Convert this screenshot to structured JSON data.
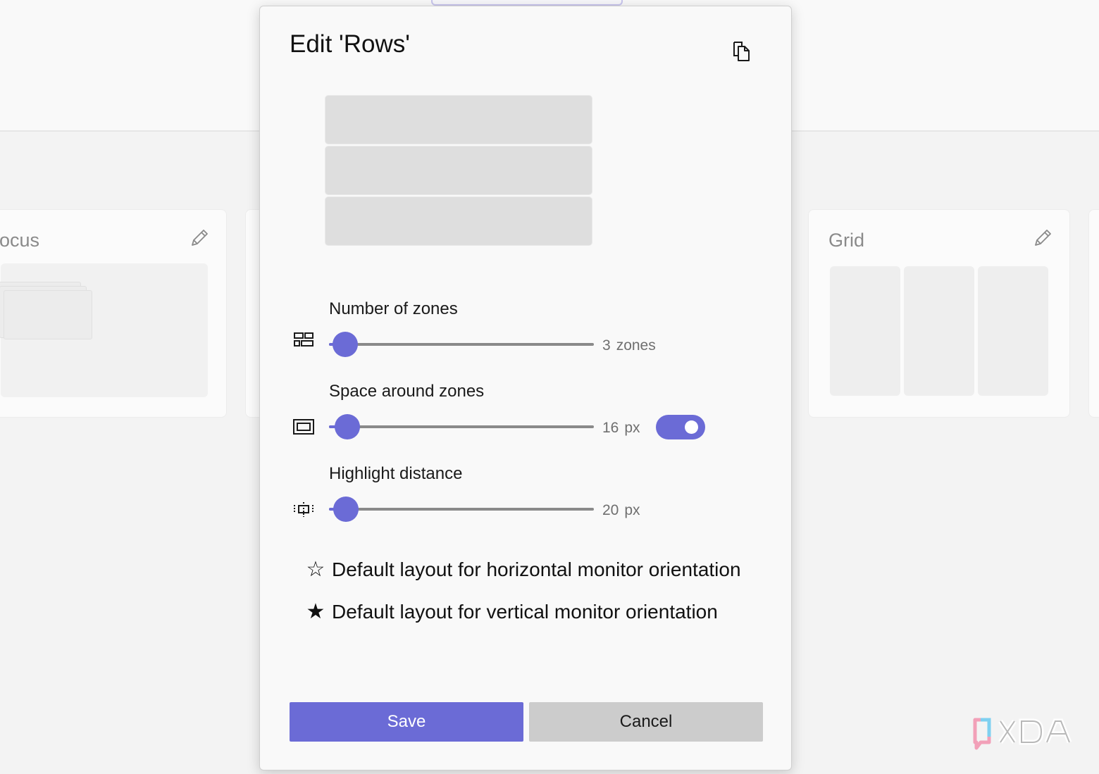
{
  "background": {
    "cards": [
      {
        "title": "ocus",
        "edit_icon": "pencil-icon"
      },
      {
        "title": "Grid",
        "edit_icon": "pencil-icon"
      }
    ]
  },
  "dialog": {
    "title": "Edit 'Rows'",
    "copy_icon": "copy-icon",
    "preview_zone_count": 3,
    "settings": [
      {
        "label": "Number of zones",
        "icon": "zones-grid-icon",
        "value": "3",
        "unit": "zones",
        "slider_fraction": 0.06
      },
      {
        "label": "Space around zones",
        "icon": "space-frame-icon",
        "value": "16",
        "unit": "px",
        "slider_fraction": 0.07,
        "toggle_on": true
      },
      {
        "label": "Highlight distance",
        "icon": "highlight-distance-icon",
        "value": "20",
        "unit": "px",
        "slider_fraction": 0.065
      }
    ],
    "defaults": [
      {
        "label": "Default layout for horizontal monitor orientation",
        "star": "☆",
        "selected": false
      },
      {
        "label": "Default layout for vertical monitor orientation",
        "star": "★",
        "selected": true
      }
    ],
    "save_label": "Save",
    "cancel_label": "Cancel"
  },
  "colors": {
    "accent": "#6b6bd6",
    "cancel_bg": "#cccccc"
  }
}
